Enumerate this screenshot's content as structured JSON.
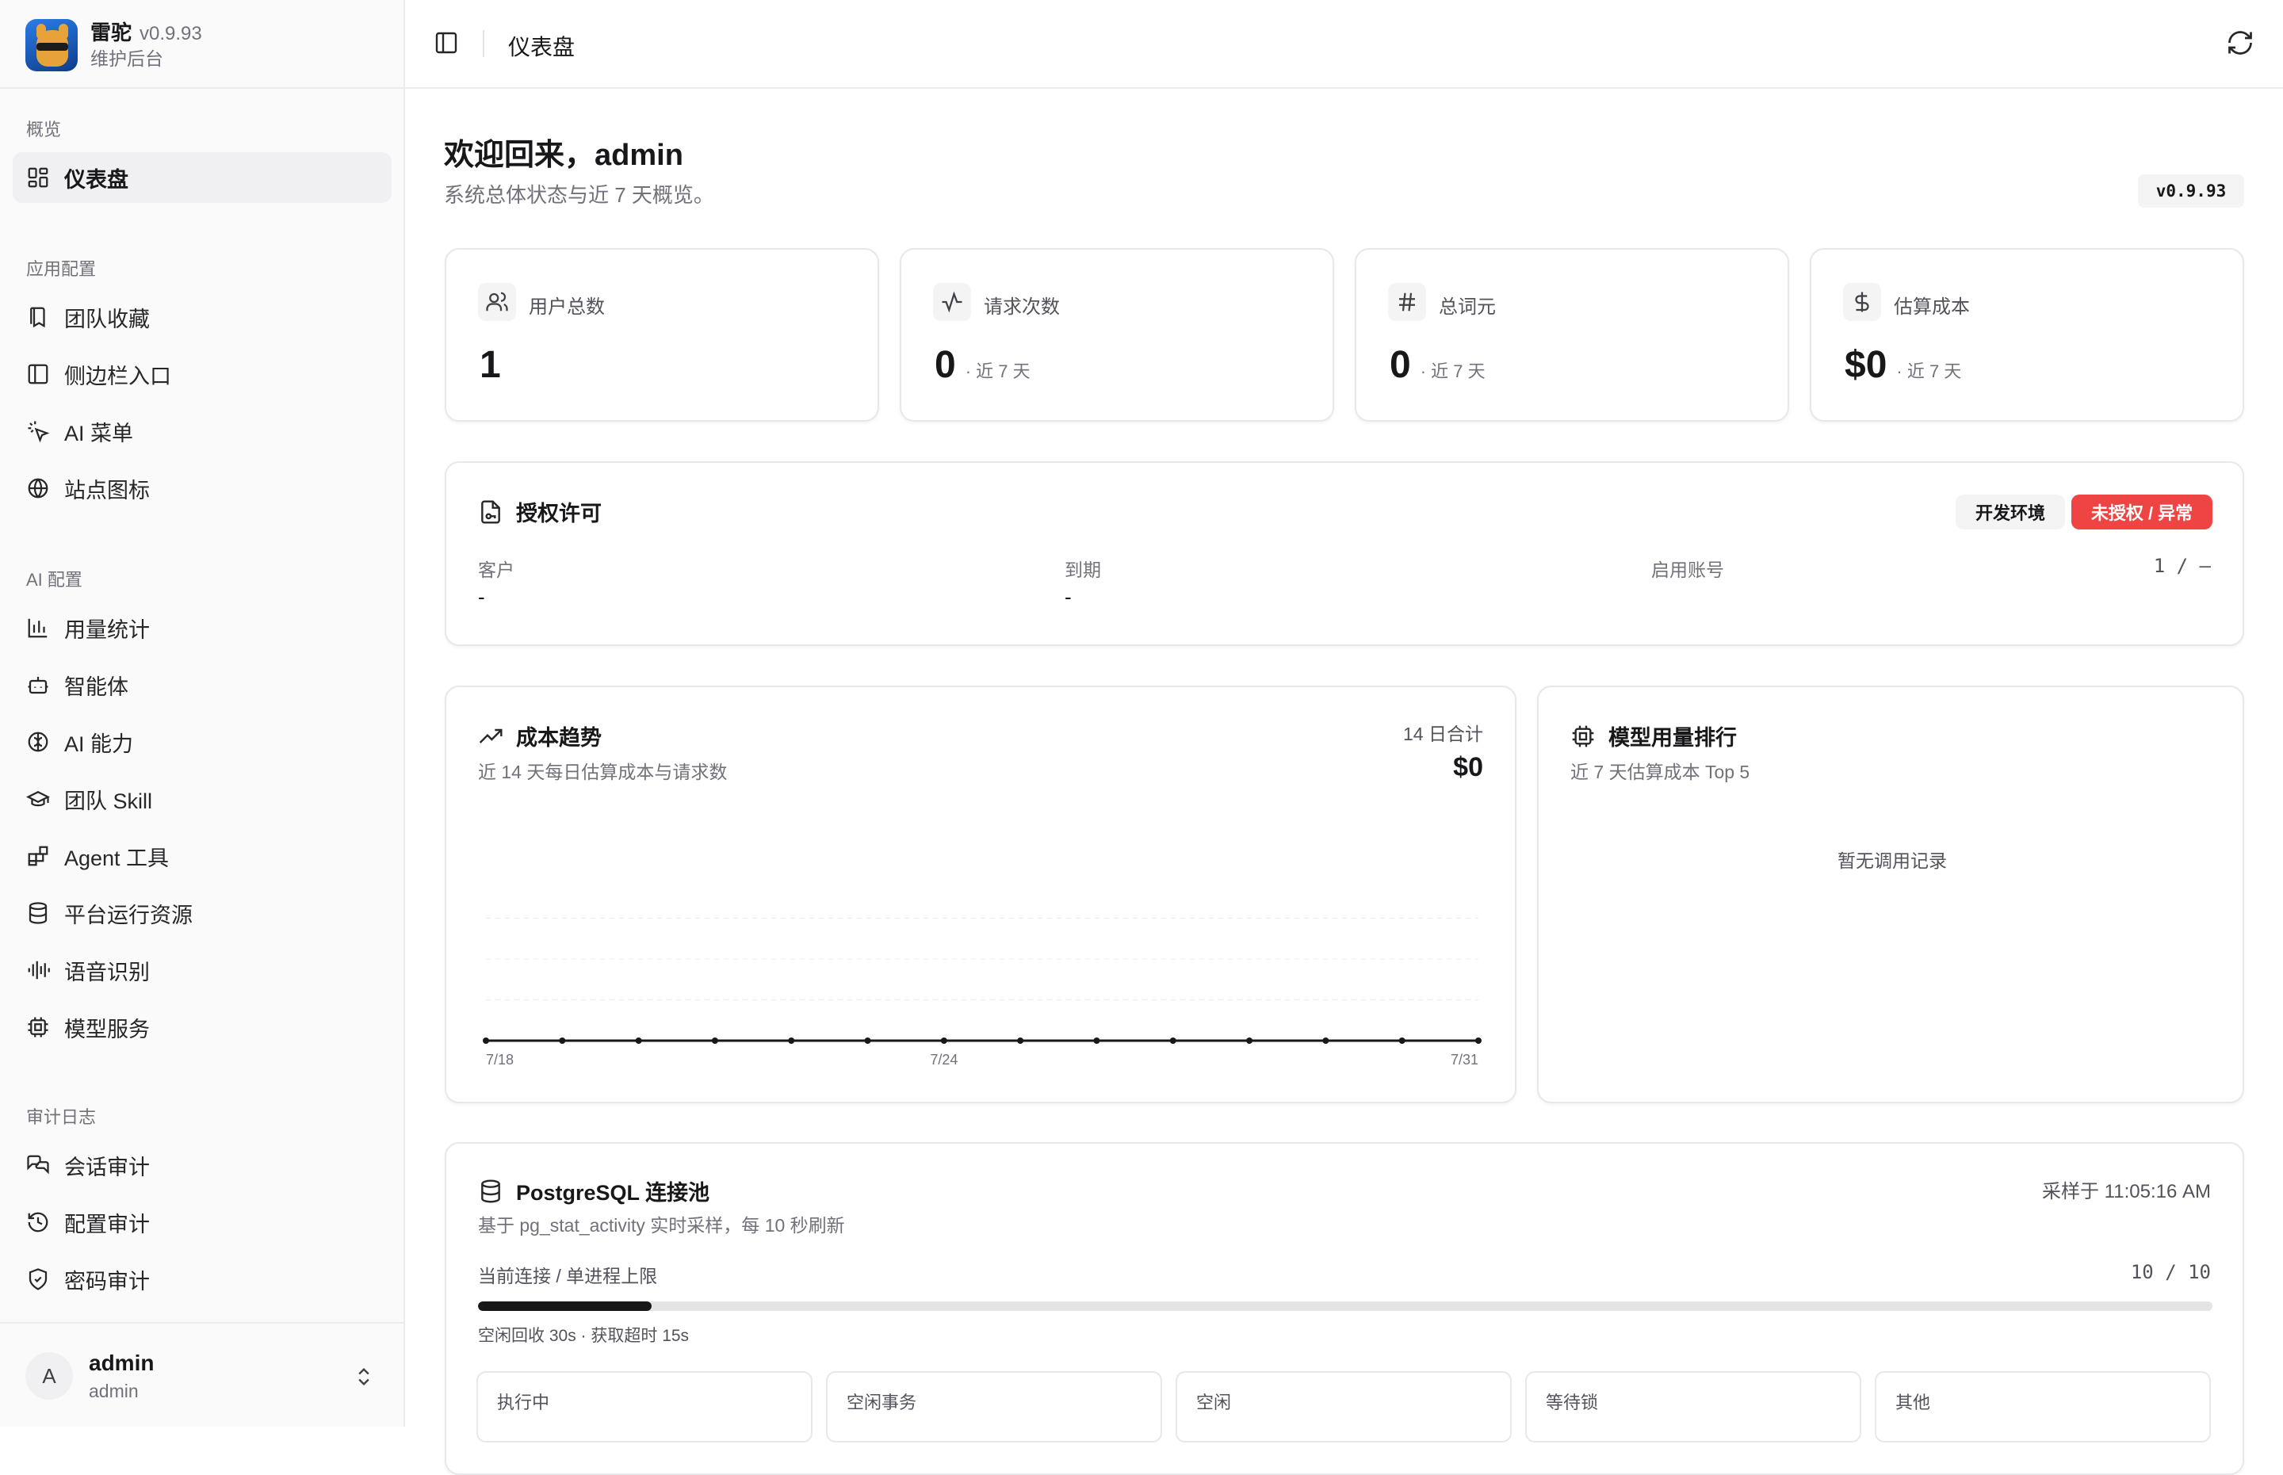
{
  "app": {
    "name": "雷驼",
    "version": "v0.9.93",
    "subtitle": "维护后台"
  },
  "sidebar": {
    "sections": [
      {
        "label": "概览",
        "items": [
          {
            "label": "仪表盘",
            "icon": "dashboard-icon",
            "active": true
          }
        ]
      },
      {
        "label": "应用配置",
        "items": [
          {
            "label": "团队收藏",
            "icon": "bookmark-icon"
          },
          {
            "label": "侧边栏入口",
            "icon": "sidebar-icon"
          },
          {
            "label": "AI 菜单",
            "icon": "pointer-click-icon"
          },
          {
            "label": "站点图标",
            "icon": "globe-icon"
          }
        ]
      },
      {
        "label": "AI 配置",
        "items": [
          {
            "label": "用量统计",
            "icon": "bar-chart-icon"
          },
          {
            "label": "智能体",
            "icon": "bot-icon"
          },
          {
            "label": "AI 能力",
            "icon": "brain-icon"
          },
          {
            "label": "团队 Skill",
            "icon": "graduation-cap-icon"
          },
          {
            "label": "Agent 工具",
            "icon": "blocks-icon"
          },
          {
            "label": "平台运行资源",
            "icon": "database-icon"
          },
          {
            "label": "语音识别",
            "icon": "audio-lines-icon"
          },
          {
            "label": "模型服务",
            "icon": "cpu-icon"
          }
        ]
      },
      {
        "label": "审计日志",
        "items": [
          {
            "label": "会话审计",
            "icon": "messages-icon"
          },
          {
            "label": "配置审计",
            "icon": "history-icon"
          },
          {
            "label": "密码审计",
            "icon": "shield-icon"
          }
        ]
      }
    ],
    "user": {
      "initial": "A",
      "name": "admin",
      "sub": "admin"
    }
  },
  "topbar": {
    "title": "仪表盘"
  },
  "welcome": {
    "title": "欢迎回来，admin",
    "subtitle": "系统总体状态与近 7 天概览。",
    "version_badge": "v0.9.93"
  },
  "stats": [
    {
      "label": "用户总数",
      "value": "1",
      "suffix": "",
      "icon": "users-icon"
    },
    {
      "label": "请求次数",
      "value": "0",
      "suffix": "· 近 7 天",
      "icon": "activity-icon"
    },
    {
      "label": "总词元",
      "value": "0",
      "suffix": "· 近 7 天",
      "icon": "hash-icon"
    },
    {
      "label": "估算成本",
      "value": "$0",
      "suffix": "· 近 7 天",
      "icon": "dollar-icon"
    }
  ],
  "license": {
    "title": "授权许可",
    "env_badge": "开发环境",
    "status_badge": "未授权 / 异常",
    "status_color": "#ef4444",
    "customer_label": "客户",
    "customer_value": "-",
    "expiry_label": "到期",
    "expiry_value": "-",
    "accounts_label": "启用账号",
    "accounts_value": "1 / –"
  },
  "cost_trend": {
    "title": "成本趋势",
    "subtitle": "近 14 天每日估算成本与请求数",
    "total_label": "14 日合计",
    "total_value": "$0"
  },
  "chart_data": {
    "type": "line",
    "x": [
      "7/18",
      "7/19",
      "7/20",
      "7/21",
      "7/22",
      "7/23",
      "7/24",
      "7/25",
      "7/26",
      "7/27",
      "7/28",
      "7/29",
      "7/30",
      "7/31"
    ],
    "tick_labels": [
      "7/18",
      "7/24",
      "7/31"
    ],
    "series": [
      {
        "values": [
          0,
          0,
          0,
          0,
          0,
          0,
          0,
          0,
          0,
          0,
          0,
          0,
          0,
          0
        ]
      }
    ],
    "grid": true,
    "line_color": "#18181b"
  },
  "model_rank": {
    "title": "模型用量排行",
    "subtitle": "近 7 天估算成本 Top 5",
    "empty": "暂无调用记录"
  },
  "pg_pool": {
    "title": "PostgreSQL 连接池",
    "sampled": "采样于 11:05:16 AM",
    "subtitle": "基于 pg_stat_activity 实时采样，每 10 秒刷新",
    "current_label": "当前连接 / 单进程上限",
    "current_value": "10 / 10",
    "progress_fraction": 0.1,
    "footnote": "空闲回收 30s · 获取超时 15s",
    "boxes": [
      "执行中",
      "空闲事务",
      "空闲",
      "等待锁",
      "其他"
    ]
  }
}
